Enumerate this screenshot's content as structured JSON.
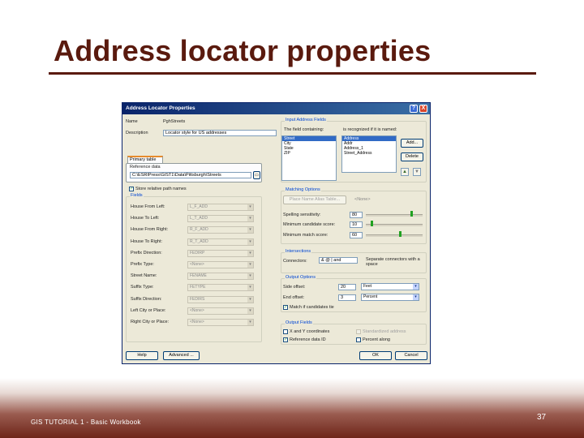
{
  "slide": {
    "title": "Address locator properties",
    "footer": "GIS TUTORIAL 1 - Basic Workbook",
    "page_number": "37",
    "colors": {
      "title": "#5a1a0e",
      "footer_band": "#6e2519"
    }
  },
  "dialog": {
    "title": "Address Locator Properties",
    "help_tb": "?",
    "close_tb": "X",
    "name_label": "Name",
    "name_value": "PghStreets",
    "description_label": "Description",
    "description_value": "Locator style for US addresses",
    "tab_label": "Primary table",
    "reference_data_label": "Reference data",
    "reference_data_path": "C:\\ESRIPress\\GIST1\\Data\\Pittsburgh\\Streets",
    "browse_icon": "folder-icon",
    "store_relative_label": "Store relative path names",
    "fields": {
      "title": "Fields",
      "rows": [
        {
          "label": "House From Left:",
          "value": "L_F_ADD"
        },
        {
          "label": "House To Left:",
          "value": "L_T_ADD"
        },
        {
          "label": "House From Right:",
          "value": "R_F_ADD"
        },
        {
          "label": "House To Right:",
          "value": "R_T_ADD"
        },
        {
          "label": "Prefix Direction:",
          "value": "FEDIRP"
        },
        {
          "label": "Prefix Type:",
          "value": "<None>"
        },
        {
          "label": "Street Name:",
          "value": "FENAME"
        },
        {
          "label": "Suffix Type:",
          "value": "FETYPE"
        },
        {
          "label": "Suffix Direction:",
          "value": "FEDIRS"
        },
        {
          "label": "Left City or Place:",
          "value": "<None>"
        },
        {
          "label": "Right City or Place:",
          "value": "<None>"
        }
      ]
    },
    "help_button": "Help",
    "advanced_button": "Advanced ...",
    "input_fields": {
      "title": "Input Address Fields",
      "left_label": "The field containing:",
      "right_label": "is recognized if it is named:",
      "left_items": [
        "Street",
        "City",
        "State",
        "ZIP"
      ],
      "right_items": [
        "Address",
        "Addr",
        "Address_1",
        "Street_Address"
      ],
      "add_button": "Add...",
      "delete_button": "Delete",
      "up_icon": "arrow-up-icon",
      "down_icon": "arrow-down-icon"
    },
    "matching": {
      "title": "Matching Options",
      "place_button": "Place Name Alias Table...",
      "place_value": "<None>",
      "spelling_label": "Spelling sensitivity:",
      "spelling_value": "80",
      "min_candidate_label": "Minimum candidate score:",
      "min_candidate_value": "10",
      "min_match_label": "Minimum match score:",
      "min_match_value": "60"
    },
    "intersections": {
      "title": "Intersections",
      "connectors_label": "Connectors:",
      "connectors_value": "& @ | and",
      "help_text": "Separate connectors with a space"
    },
    "output": {
      "title": "Output Options",
      "side_offset_label": "Side offset:",
      "side_offset_value": "20",
      "side_offset_units": "Feet",
      "end_offset_label": "End offset:",
      "end_offset_value": "3",
      "end_offset_units": "Percent",
      "match_label": "Match if candidates tie"
    },
    "output_fields": {
      "title": "Output Fields",
      "xy_label": "X and Y coordinates",
      "standardized_label": "Standardized address",
      "ref_id_label": "Reference data ID",
      "percent_label": "Percent along"
    },
    "ok_button": "OK",
    "cancel_button": "Cancel"
  }
}
